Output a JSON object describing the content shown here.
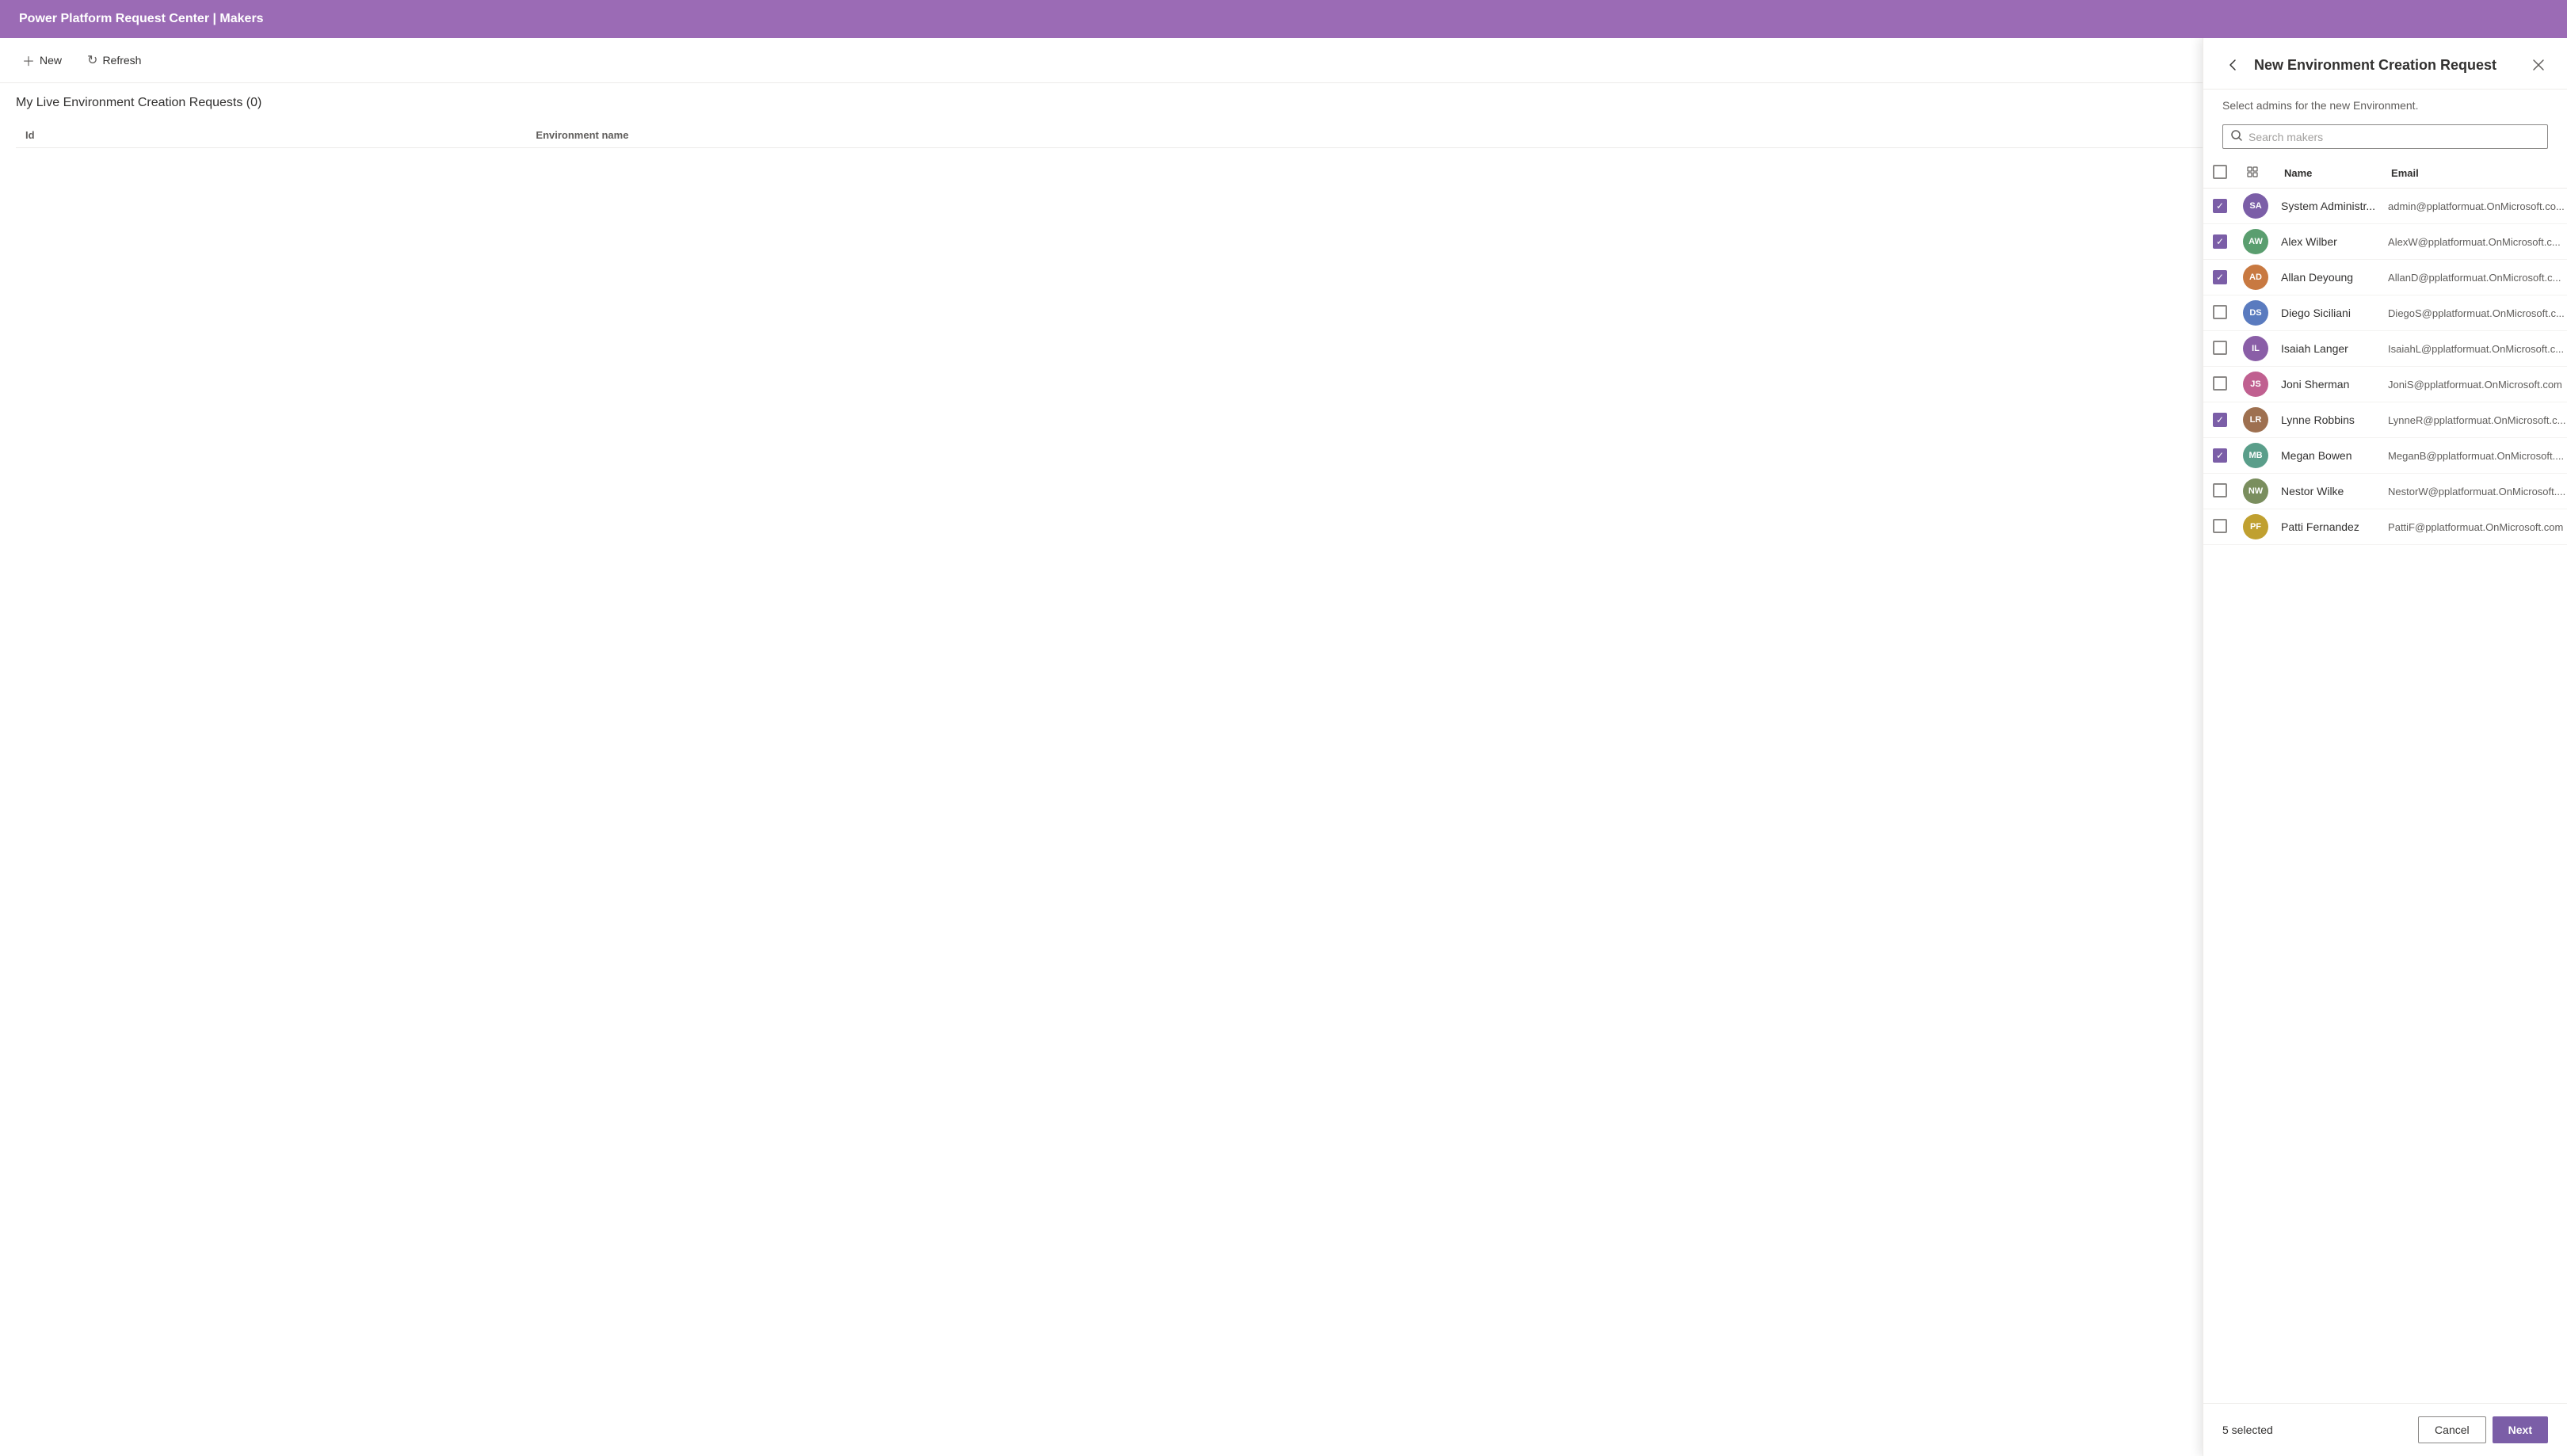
{
  "app": {
    "title": "Power Platform Request Center | Makers"
  },
  "toolbar": {
    "new_label": "New",
    "refresh_label": "Refresh"
  },
  "main": {
    "page_title": "My Live Environment Creation Requests (0)",
    "table": {
      "columns": [
        "Id",
        "Environment name"
      ],
      "rows": []
    }
  },
  "panel": {
    "title": "New Environment Creation Request",
    "subtitle": "Select admins for the new Environment.",
    "search_placeholder": "Search makers",
    "selected_count": "5 selected",
    "cancel_label": "Cancel",
    "next_label": "Next",
    "table": {
      "col_name": "Name",
      "col_email": "Email",
      "makers": [
        {
          "id": "system-admin",
          "name": "System Administr...",
          "full_name": "System Administrator",
          "email": "admin@pplatformuat.OnMicrosoft.co...",
          "checked": true,
          "avatar_type": "initials",
          "initials": "SA",
          "avatar_color": "#7b5ea7"
        },
        {
          "id": "alex-wilber",
          "name": "Alex Wilber",
          "full_name": "Alex Wilber",
          "email": "AlexW@pplatformuat.OnMicrosoft.c...",
          "checked": true,
          "avatar_type": "photo",
          "initials": "AW",
          "avatar_color": "#5a9e6f"
        },
        {
          "id": "allan-deyoung",
          "name": "Allan Deyoung",
          "full_name": "Allan Deyoung",
          "email": "AllanD@pplatformuat.OnMicrosoft.c...",
          "checked": true,
          "avatar_type": "photo",
          "initials": "AD",
          "avatar_color": "#c87941"
        },
        {
          "id": "diego-siciliani",
          "name": "Diego Siciliani",
          "full_name": "Diego Siciliani",
          "email": "DiegoS@pplatformuat.OnMicrosoft.c...",
          "checked": false,
          "avatar_type": "photo",
          "initials": "DS",
          "avatar_color": "#5a7bbf"
        },
        {
          "id": "isaiah-langer",
          "name": "Isaiah Langer",
          "full_name": "Isaiah Langer",
          "email": "IsaiahL@pplatformuat.OnMicrosoft.c...",
          "checked": false,
          "avatar_type": "photo",
          "initials": "IL",
          "avatar_color": "#8a5ea7"
        },
        {
          "id": "joni-sherman",
          "name": "Joni Sherman",
          "full_name": "Joni Sherman",
          "email": "JoniS@pplatformuat.OnMicrosoft.com",
          "checked": false,
          "avatar_type": "photo",
          "initials": "JS",
          "avatar_color": "#c06090"
        },
        {
          "id": "lynne-robbins",
          "name": "Lynne Robbins",
          "full_name": "Lynne Robbins",
          "email": "LynneR@pplatformuat.OnMicrosoft.c...",
          "checked": true,
          "avatar_type": "photo",
          "initials": "LR",
          "avatar_color": "#9e7050"
        },
        {
          "id": "megan-bowen",
          "name": "Megan Bowen",
          "full_name": "Megan Bowen",
          "email": "MeganB@pplatformuat.OnMicrosoft....",
          "checked": true,
          "avatar_type": "photo",
          "initials": "MB",
          "avatar_color": "#5a9e8a"
        },
        {
          "id": "nestor-wilke",
          "name": "Nestor Wilke",
          "full_name": "Nestor Wilke",
          "email": "NestorW@pplatformuat.OnMicrosoft....",
          "checked": false,
          "avatar_type": "photo",
          "initials": "NW",
          "avatar_color": "#7a8e5e"
        },
        {
          "id": "patti-fernandez",
          "name": "Patti Fernandez",
          "full_name": "Patti Fernandez",
          "email": "PattiF@pplatformuat.OnMicrosoft.com",
          "checked": false,
          "avatar_type": "photo",
          "initials": "PF",
          "avatar_color": "#c0a030"
        }
      ]
    }
  },
  "colors": {
    "brand": "#9b6bb5",
    "brand_dark": "#7b5ea7",
    "accent": "#7b5ea7"
  }
}
